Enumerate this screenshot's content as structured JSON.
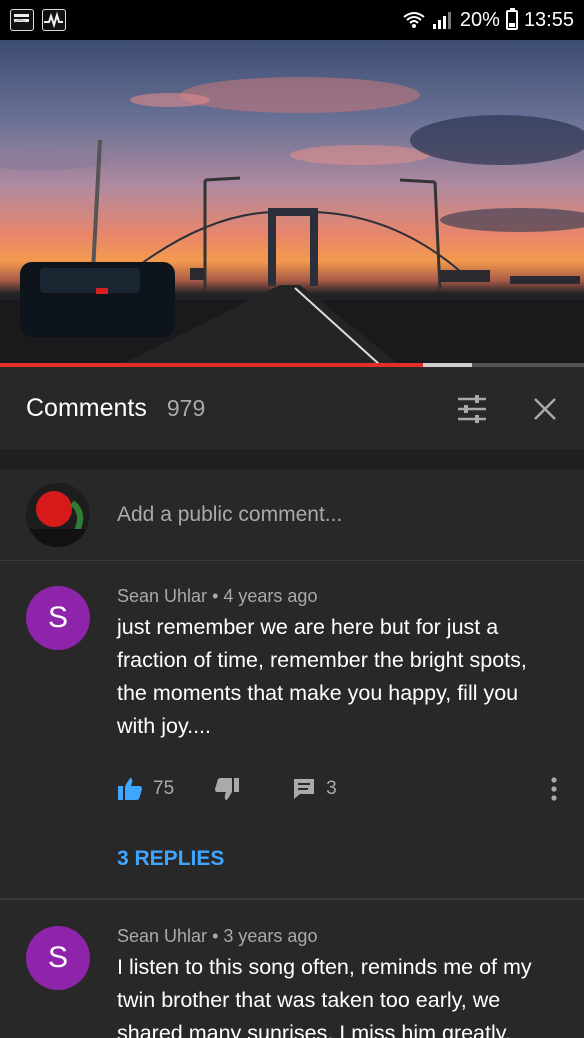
{
  "status_bar": {
    "left_icons": [
      "espn-icon",
      "pulse-icon"
    ],
    "battery": "20%",
    "time": "13:55"
  },
  "video": {
    "progress_fraction": 0.725,
    "buffer_fraction": 0.808
  },
  "header": {
    "title": "Comments",
    "count": "979",
    "icons": [
      "filter-icon",
      "close-icon"
    ]
  },
  "add_comment": {
    "placeholder": "Add a public comment..."
  },
  "comments": [
    {
      "avatar_letter": "S",
      "author": "Sean Uhlar",
      "age": "4 years ago",
      "text": "just remember we are here but for just a fraction of time, remember the bright spots, the moments that make you happy, fill you with joy....",
      "likes": "75",
      "replies_count": "3",
      "replies_label": "3 REPLIES"
    },
    {
      "avatar_letter": "S",
      "author": "Sean Uhlar",
      "age": "3 years ago",
      "text": "I listen to this song often, reminds me of my twin brother that was taken too early, we shared many sunrises. I miss him greatly."
    }
  ],
  "colors": {
    "background": "#282828",
    "accent_red": "#e52d27",
    "link_blue": "#3ea6ff",
    "avatar_purple": "#8e24aa"
  }
}
